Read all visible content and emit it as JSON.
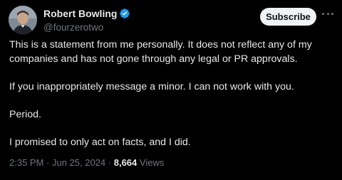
{
  "author": {
    "display_name": "Robert Bowling",
    "handle": "@fourzerotwo",
    "verified": true
  },
  "actions": {
    "subscribe_label": "Subscribe"
  },
  "tweet": {
    "paragraphs": [
      "This is a statement from me personally. It does not reflect any of my",
      "companies and has not gone through any legal or PR approvals.",
      "If you inappropriately message a minor. I can not work with you.",
      "Period.",
      "I promised to only act on facts, and I did."
    ]
  },
  "meta": {
    "time": "2:35 PM",
    "separator": " · ",
    "date": "Jun 25, 2024",
    "views_count": "8,664",
    "views_label": "Views"
  },
  "colors": {
    "background": "#000000",
    "text": "#e7e9ea",
    "secondary": "#71767b",
    "verified_badge": "#1d9bf0",
    "subscribe_bg": "#eff3f4"
  },
  "icons": {
    "verified": "verified-badge-icon",
    "more": "more-options-icon"
  }
}
